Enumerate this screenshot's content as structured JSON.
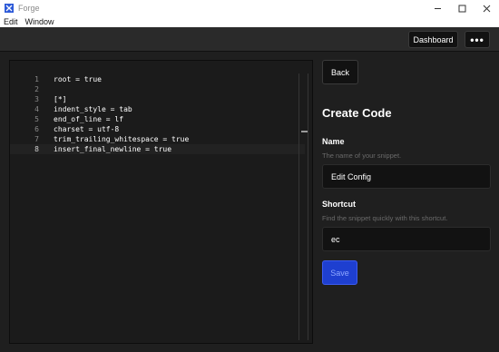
{
  "window": {
    "title": "Forge",
    "controls": [
      "minimize-icon",
      "maximize-icon",
      "close-icon"
    ]
  },
  "menu": {
    "items": [
      "Edit",
      "Window"
    ]
  },
  "topbar": {
    "dashboard_label": "Dashboard",
    "more_label": "•••"
  },
  "editor": {
    "lines": [
      {
        "num": "1",
        "text": "root = true"
      },
      {
        "num": "2",
        "text": ""
      },
      {
        "num": "3",
        "text": "[*]"
      },
      {
        "num": "4",
        "text": "indent_style = tab"
      },
      {
        "num": "5",
        "text": "end_of_line = lf"
      },
      {
        "num": "6",
        "text": "charset = utf-8"
      },
      {
        "num": "7",
        "text": "trim_trailing_whitespace = true"
      },
      {
        "num": "8",
        "text": "insert_final_newline = true"
      }
    ],
    "active_line": 8
  },
  "form": {
    "back_label": "Back",
    "title": "Create Code",
    "name_label": "Name",
    "name_hint": "The name of your snippet.",
    "name_value": "Edit Config",
    "shortcut_label": "Shortcut",
    "shortcut_hint": "Find the snippet quickly with this shortcut.",
    "shortcut_value": "ec",
    "save_label": "Save"
  },
  "colors": {
    "accent": "#1e3fd0",
    "background": "#1f1f1f",
    "editor_bg": "#1b1b1b"
  }
}
